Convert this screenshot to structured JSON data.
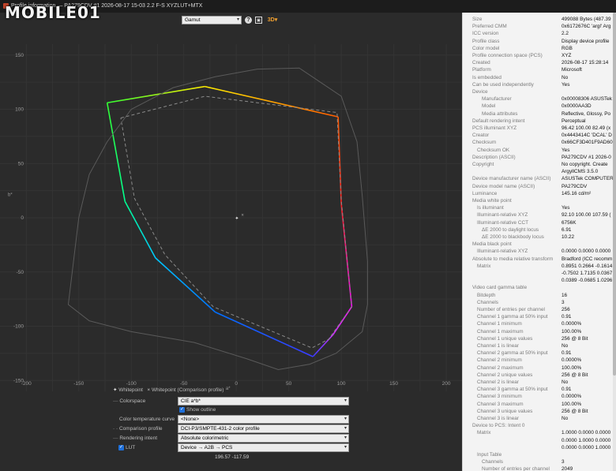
{
  "window": {
    "title": "Profile information — PA279CDV #1 2026-08-17 15-03 2.2 F-S XYZLUT+MTX"
  },
  "watermark": {
    "text": "MOBILE01"
  },
  "toolbar": {
    "view_select": "Gamut",
    "help_icon": "help-icon",
    "image_icon": "image-icon",
    "3d_icon": "3d-view-icon",
    "3d_label": "3D"
  },
  "chart_data": {
    "type": "line",
    "xlabel": "a*",
    "ylabel": "b*",
    "xlim": [
      -210,
      215
    ],
    "ylim": [
      -160,
      160
    ],
    "xticks": [
      -200,
      -150,
      -100,
      -50,
      0,
      50,
      100,
      150,
      200
    ],
    "yticks": [
      150,
      100,
      50,
      0,
      -50,
      -100,
      -150
    ],
    "grid": true,
    "series": [
      {
        "style": "solid-colored",
        "points": [
          [
            -123,
            106
          ],
          [
            -30,
            121
          ],
          [
            97,
            93
          ],
          [
            100,
            13
          ],
          [
            110,
            -82
          ],
          [
            92,
            -108
          ],
          [
            73,
            -128
          ],
          [
            -20,
            -87
          ],
          [
            -77,
            -37
          ],
          [
            -106,
            15
          ],
          [
            -123,
            106
          ]
        ],
        "colors": [
          "#33ff33",
          "#ffee00",
          "#ff5a00",
          "#ff1f1f",
          "#ff00ff",
          "#cc33ff",
          "#3a3aff",
          "#0070ff",
          "#00c8ff",
          "#00ff90",
          "#33ff33"
        ]
      },
      {
        "style": "dashed",
        "points": [
          [
            -110,
            92
          ],
          [
            -30,
            112
          ],
          [
            96,
            97
          ],
          [
            100,
            16
          ],
          [
            110,
            -82
          ],
          [
            88,
            -112
          ],
          [
            72,
            -120
          ],
          [
            -22,
            -82
          ],
          [
            -68,
            -34
          ],
          [
            -97,
            18
          ],
          [
            -110,
            92
          ]
        ]
      },
      {
        "style": "spectral-locus",
        "points": [
          [
            -160,
            -80
          ],
          [
            -155,
            -40
          ],
          [
            -150,
            0
          ],
          [
            -140,
            40
          ],
          [
            -123,
            70
          ],
          [
            -100,
            100
          ],
          [
            -60,
            120
          ],
          [
            -20,
            130
          ],
          [
            20,
            137
          ],
          [
            60,
            138
          ],
          [
            100,
            112
          ],
          [
            115,
            70
          ],
          [
            120,
            20
          ],
          [
            125,
            -40
          ],
          [
            125,
            -80
          ],
          [
            120,
            -105
          ],
          [
            95,
            -125
          ],
          [
            70,
            -135
          ],
          [
            40,
            -140
          ],
          [
            10,
            -130
          ],
          [
            -40,
            -115
          ],
          [
            -100,
            -105
          ],
          [
            -140,
            -95
          ],
          [
            -160,
            -80
          ]
        ]
      }
    ],
    "whitepoints": [
      [
        0.5,
        -0.5
      ],
      [
        6,
        2.5
      ]
    ]
  },
  "legend": {
    "whitepoint": "Whitepoint",
    "whitepoint_comparison": "Whitepoint (Comparison profile)"
  },
  "controls": {
    "colorspace_label": "Colorspace",
    "colorspace_value": "CIE a*b*",
    "show_outline_label": "Show outline",
    "color_temp_label": "Color temperature curve",
    "color_temp_value": "<None>",
    "comparison_label": "Comparison profile",
    "comparison_value": "DCI-P3/SMPTE-431-2 color profile",
    "rendering_label": "Rendering intent",
    "rendering_value": "Absolute colorimetric",
    "lut_label": "LUT",
    "lut_value": "Device → A2B → PCS",
    "coords": "196.57 -117.59"
  },
  "info": [
    {
      "k": "Size",
      "v": "499088 Bytes (487.39",
      "indent": 0
    },
    {
      "k": "Preferred CMM",
      "v": "0x6172676C 'argl' Arg",
      "indent": 0
    },
    {
      "k": "ICC version",
      "v": "2.2",
      "indent": 0
    },
    {
      "k": "Profile class",
      "v": "Display device profile",
      "indent": 0
    },
    {
      "k": "Color model",
      "v": "RGB",
      "indent": 0
    },
    {
      "k": "Profile connection space (PCS)",
      "v": "XYZ",
      "indent": 0
    },
    {
      "k": "Created",
      "v": "2026-08-17 15:28:14",
      "indent": 0
    },
    {
      "k": "Platform",
      "v": "Microsoft",
      "indent": 0
    },
    {
      "k": "Is embedded",
      "v": "No",
      "indent": 0
    },
    {
      "k": "Can be used independently",
      "v": "Yes",
      "indent": 0
    },
    {
      "k": "Device",
      "v": "",
      "indent": 0
    },
    {
      "k": "Manufacturer",
      "v": "0x00008306 ASUSTek",
      "indent": 2
    },
    {
      "k": "Model",
      "v": "0x0000AA3D",
      "indent": 2
    },
    {
      "k": "Media attributes",
      "v": "Reflective, Glossy, Po",
      "indent": 2
    },
    {
      "k": "Default rendering intent",
      "v": "Perceptual",
      "indent": 0
    },
    {
      "k": "PCS illuminant XYZ",
      "v": "96.42 100.00  82.49 (x",
      "indent": 0
    },
    {
      "k": "Creator",
      "v": "0x4443414C 'DCAL' D",
      "indent": 0
    },
    {
      "k": "Checksum",
      "v": "0x66CF3D401F9AD60",
      "indent": 0
    },
    {
      "k": "Checksum OK",
      "v": "Yes",
      "indent": 1
    },
    {
      "k": "Description (ASCII)",
      "v": "PA279CDV #1 2026-0",
      "indent": 0
    },
    {
      "k": "Copyright",
      "v": "No copyright. Create",
      "indent": 0
    },
    {
      "k": "",
      "v": "ArgyllCMS 3.5.0",
      "indent": 0
    },
    {
      "k": "Device manufacturer name (ASCII)",
      "v": "ASUSTek COMPUTER",
      "indent": 0
    },
    {
      "k": "Device model name (ASCII)",
      "v": "PA279CDV",
      "indent": 0
    },
    {
      "k": "Luminance",
      "v": "145.16 cd/m²",
      "indent": 0
    },
    {
      "k": "Media white point",
      "v": "",
      "indent": 0
    },
    {
      "k": "Is illuminant",
      "v": "Yes",
      "indent": 1
    },
    {
      "k": "Illuminant-relative XYZ",
      "v": "92.10 100.00 107.59 (",
      "indent": 1
    },
    {
      "k": "Illuminant-relative CCT",
      "v": "6756K",
      "indent": 1
    },
    {
      "k": "ΔE 2000 to daylight locus",
      "v": "6.91",
      "indent": 2
    },
    {
      "k": "ΔE 2000 to blackbody locus",
      "v": "10.22",
      "indent": 2
    },
    {
      "k": "Media black point",
      "v": "",
      "indent": 0
    },
    {
      "k": "Illuminant-relative XYZ",
      "v": "0.0000 0.0000 0.0000",
      "indent": 1
    },
    {
      "k": "Absolute to media relative transform",
      "v": "Bradford (ICC recomm",
      "indent": 0
    },
    {
      "k": "Matrix",
      "v": "0.8951  0.2664 -0.1614",
      "indent": 1
    },
    {
      "k": "",
      "v": "-0.7502  1.7135  0.0367",
      "indent": 0
    },
    {
      "k": "",
      "v": "0.0389 -0.0685  1.0296",
      "indent": 0
    },
    {
      "k": "Video card gamma table",
      "v": "",
      "indent": 0
    },
    {
      "k": "Bitdepth",
      "v": "16",
      "indent": 1
    },
    {
      "k": "Channels",
      "v": "3",
      "indent": 1
    },
    {
      "k": "Number of entries per channel",
      "v": "256",
      "indent": 1
    },
    {
      "k": "Channel 1 gamma at 50% input",
      "v": "0.91",
      "indent": 1
    },
    {
      "k": "Channel 1 minimum",
      "v": "0.0000%",
      "indent": 1
    },
    {
      "k": "Channel 1 maximum",
      "v": "100.00%",
      "indent": 1
    },
    {
      "k": "Channel 1 unique values",
      "v": "256 @ 8 Bit",
      "indent": 1
    },
    {
      "k": "Channel 1 is linear",
      "v": "No",
      "indent": 1
    },
    {
      "k": "Channel 2 gamma at 50% input",
      "v": "0.91",
      "indent": 1
    },
    {
      "k": "Channel 2 minimum",
      "v": "0.0000%",
      "indent": 1
    },
    {
      "k": "Channel 2 maximum",
      "v": "100.00%",
      "indent": 1
    },
    {
      "k": "Channel 2 unique values",
      "v": "256 @ 8 Bit",
      "indent": 1
    },
    {
      "k": "Channel 2 is linear",
      "v": "No",
      "indent": 1
    },
    {
      "k": "Channel 3 gamma at 50% input",
      "v": "0.91",
      "indent": 1
    },
    {
      "k": "Channel 3 minimum",
      "v": "0.0000%",
      "indent": 1
    },
    {
      "k": "Channel 3 maximum",
      "v": "100.00%",
      "indent": 1
    },
    {
      "k": "Channel 3 unique values",
      "v": "256 @ 8 Bit",
      "indent": 1
    },
    {
      "k": "Channel 3 is linear",
      "v": "No",
      "indent": 1
    },
    {
      "k": "Device to PCS: Intent 0",
      "v": "",
      "indent": 0
    },
    {
      "k": "Matrix",
      "v": "1.0000  0.0000  0.0000",
      "indent": 1
    },
    {
      "k": "",
      "v": "0.0000  1.0000  0.0000",
      "indent": 0
    },
    {
      "k": "",
      "v": "0.0000  0.0000  1.0000",
      "indent": 0
    },
    {
      "k": "Input Table",
      "v": "",
      "indent": 1
    },
    {
      "k": "Channels",
      "v": "3",
      "indent": 2
    },
    {
      "k": "Number of entries per channel",
      "v": "2049",
      "indent": 2
    }
  ]
}
